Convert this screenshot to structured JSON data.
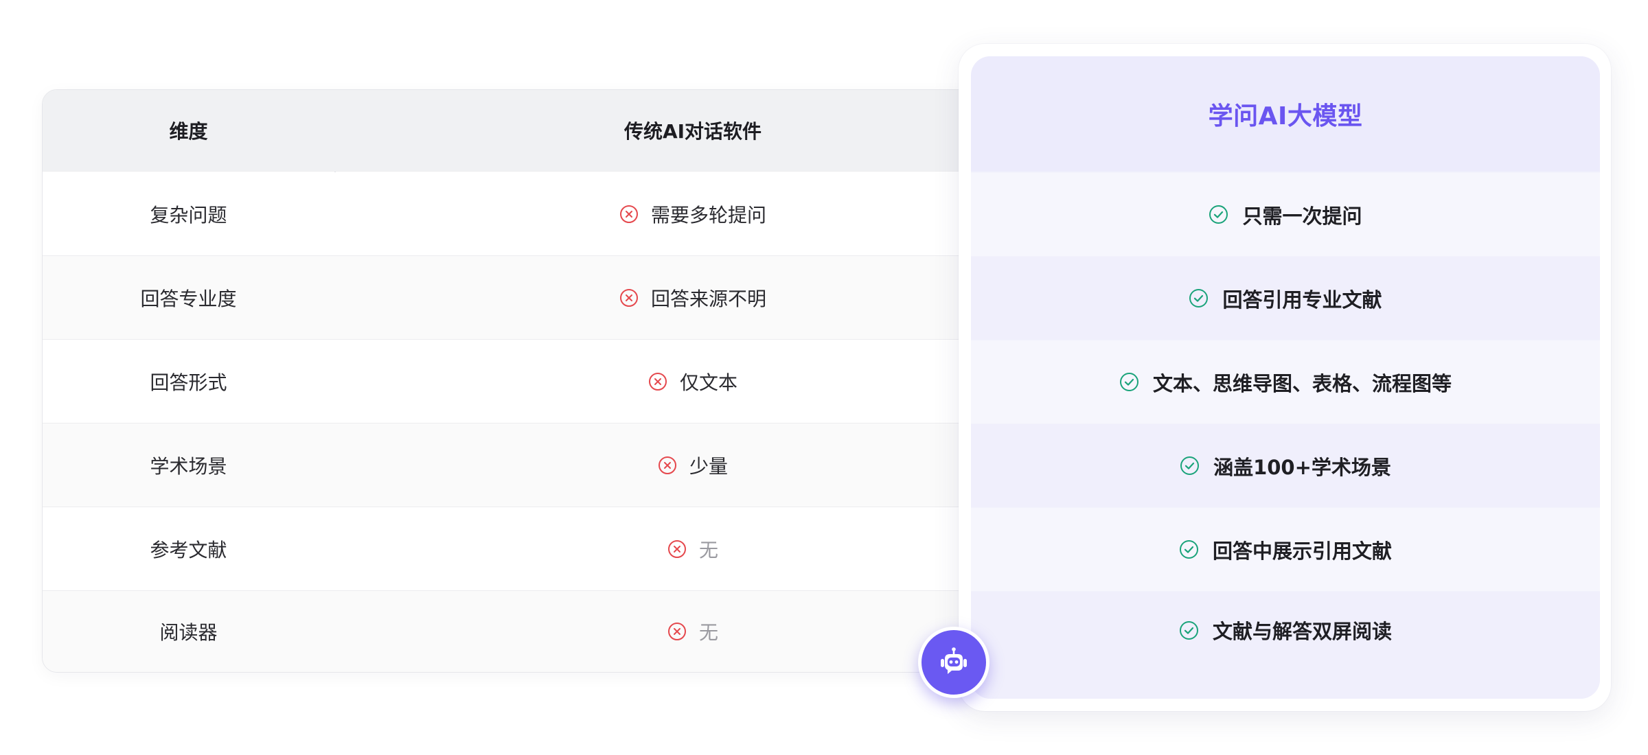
{
  "table": {
    "header": {
      "dimension": "维度",
      "traditional": "传统AI对话软件"
    },
    "rows": [
      {
        "dimension": "复杂问题",
        "traditional": "需要多轮提问"
      },
      {
        "dimension": "回答专业度",
        "traditional": "回答来源不明"
      },
      {
        "dimension": "回答形式",
        "traditional": "仅文本"
      },
      {
        "dimension": "学术场景",
        "traditional": "少量"
      },
      {
        "dimension": "参考文献",
        "traditional": "无"
      },
      {
        "dimension": "阅读器",
        "traditional": "无"
      }
    ]
  },
  "highlight": {
    "title": "学问AI大模型",
    "rows": [
      "只需一次提问",
      "回答引用专业文献",
      "文本、思维导图、表格、流程图等",
      "涵盖100+学术场景",
      "回答中展示引用文献",
      "文献与解答双屏阅读"
    ]
  },
  "icons": {
    "negative": "x-circle-icon",
    "positive": "check-circle-icon",
    "assistant": "robot-icon"
  },
  "colors": {
    "accent": "#6a55f0",
    "negative": "#e5484d",
    "positive": "#1aa37a",
    "muted_text": "#9a9aa0"
  }
}
